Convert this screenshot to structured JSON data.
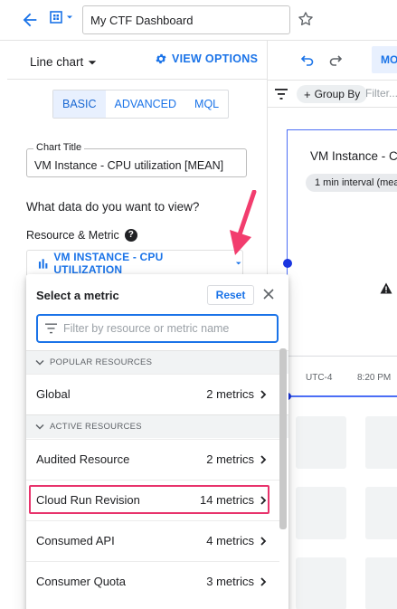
{
  "header": {
    "dashboard_name": "My CTF Dashboard"
  },
  "left_panel": {
    "chart_type": "Line chart",
    "view_options": "VIEW OPTIONS",
    "tabs": [
      {
        "label": "BASIC",
        "active": true
      },
      {
        "label": "ADVANCED",
        "active": false
      },
      {
        "label": "MQL",
        "active": false
      }
    ],
    "chart_title_label": "Chart Title",
    "chart_title_value": "VM Instance - CPU utilization [MEAN]",
    "question": "What data do you want to view?",
    "resource_metric_label": "Resource & Metric",
    "help": "?",
    "metric_selected": "VM INSTANCE - CPU UTILIZATION"
  },
  "right_area": {
    "mode_label": "MO",
    "group_by": "Group By",
    "filter_placeholder": "Filter...",
    "chart_title": "VM Instance - CI",
    "interval_chip": "1 min interval (mea",
    "tick_utc": "UTC-4",
    "tick_time": "8:20 PM"
  },
  "metric_popup": {
    "title": "Select a metric",
    "reset": "Reset",
    "search_placeholder": "Filter by resource or metric name",
    "popular_header": "POPULAR RESOURCES",
    "active_header": "ACTIVE RESOURCES",
    "popular": [
      {
        "name": "Global",
        "count": "2 metrics"
      }
    ],
    "active": [
      {
        "name": "Audited Resource",
        "count": "2 metrics"
      },
      {
        "name": "Cloud Run Revision",
        "count": "14 metrics"
      },
      {
        "name": "Consumed API",
        "count": "4 metrics"
      },
      {
        "name": "Consumer Quota",
        "count": "3 metrics"
      }
    ]
  },
  "colors": {
    "accent": "#1a73e8",
    "highlight": "#e8336c",
    "annotation_arrow": "#f23d6e"
  },
  "icons": [
    "back-arrow-icon",
    "dashboard-icon",
    "star-icon",
    "caret-down-icon",
    "gear-icon",
    "help-icon",
    "bar-chart-icon",
    "close-icon",
    "filter-icon",
    "chevron-right-icon",
    "undo-icon",
    "redo-icon",
    "warning-icon"
  ]
}
